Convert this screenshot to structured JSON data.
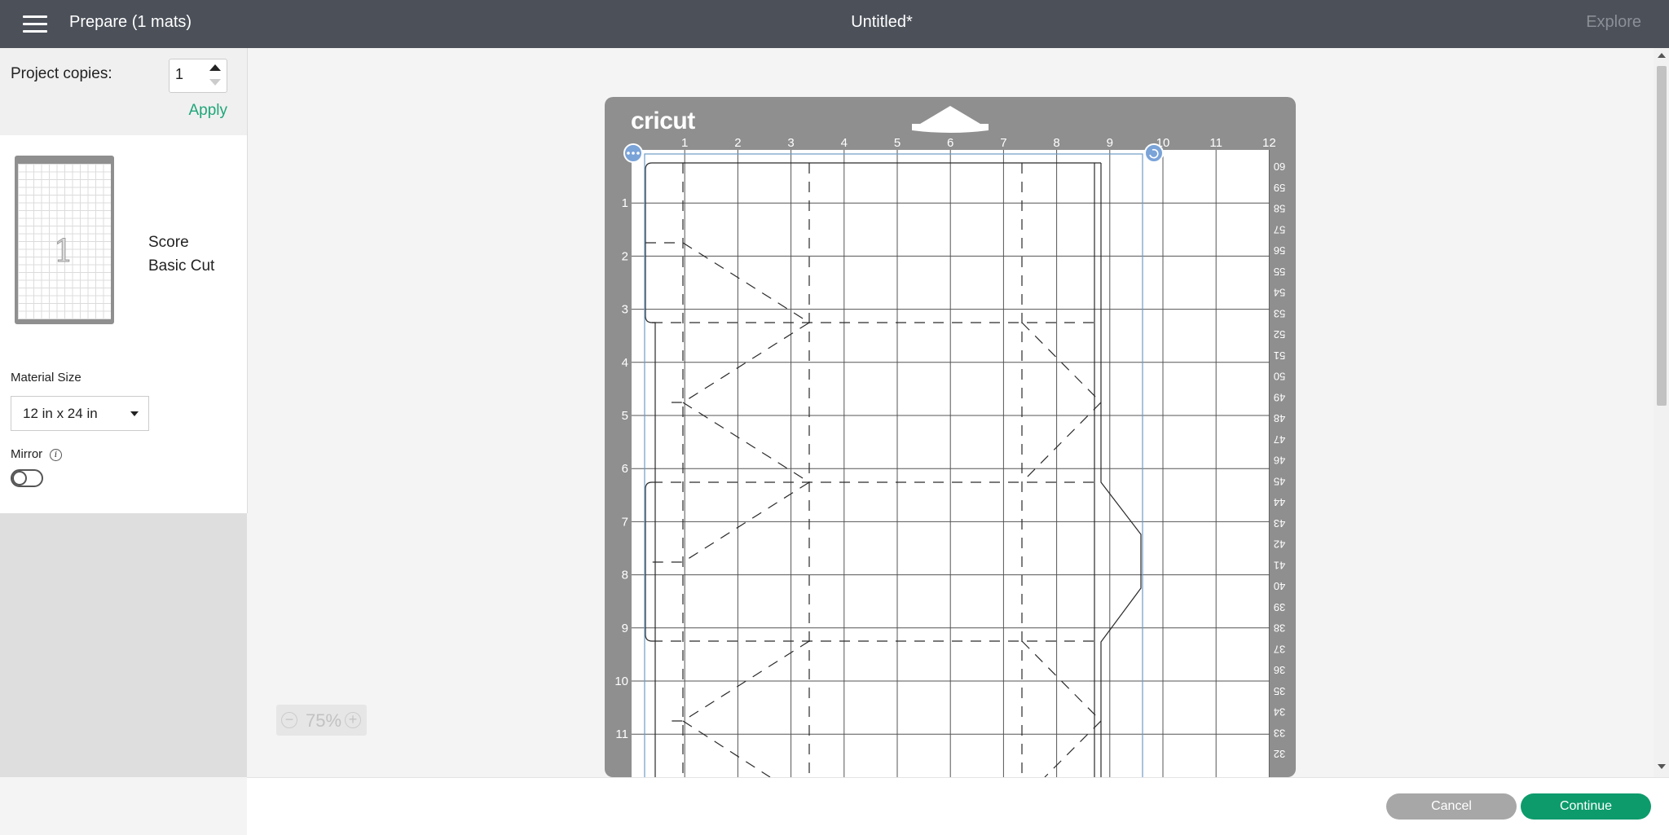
{
  "topbar": {
    "title": "Prepare (1 mats)",
    "document_title": "Untitled*",
    "explore_label": "Explore"
  },
  "panel": {
    "copies_label": "Project copies:",
    "copies_value": "1",
    "apply_label": "Apply",
    "mat_thumb_number": "1",
    "operations": [
      "Score",
      "Basic Cut"
    ],
    "material_size_label": "Material Size",
    "material_size_value": "12 in x 24 in",
    "mirror_label": "Mirror",
    "mirror_on": false
  },
  "mat": {
    "brand": "cricut",
    "top_ruler": [
      "1",
      "2",
      "3",
      "4",
      "5",
      "6",
      "7",
      "8",
      "9",
      "10",
      "11",
      "12"
    ],
    "left_ruler": [
      "1",
      "2",
      "3",
      "4",
      "5",
      "6",
      "7",
      "8",
      "9",
      "10",
      "11"
    ],
    "right_ruler": [
      "60",
      "59",
      "58",
      "57",
      "56",
      "55",
      "54",
      "53",
      "52",
      "51",
      "50",
      "49",
      "48",
      "47",
      "46",
      "45",
      "44",
      "43",
      "42",
      "41",
      "40",
      "39",
      "38",
      "37",
      "36",
      "35",
      "34",
      "33",
      "32"
    ]
  },
  "zoom": {
    "value": "75%"
  },
  "footer": {
    "cancel_label": "Cancel",
    "continue_label": "Continue"
  },
  "colors": {
    "topbar": "#4b5059",
    "accent": "#0d9b6c",
    "apply": "#1fa67a",
    "mat": "#8f8f8f",
    "selection": "#6e9bc4"
  },
  "icons": {
    "menu": "hamburger-icon",
    "zoom_out": "minus-circle-icon",
    "zoom_in": "plus-circle-icon",
    "more": "ellipsis-icon",
    "rotate": "rotate-icon",
    "info": "info-icon"
  }
}
